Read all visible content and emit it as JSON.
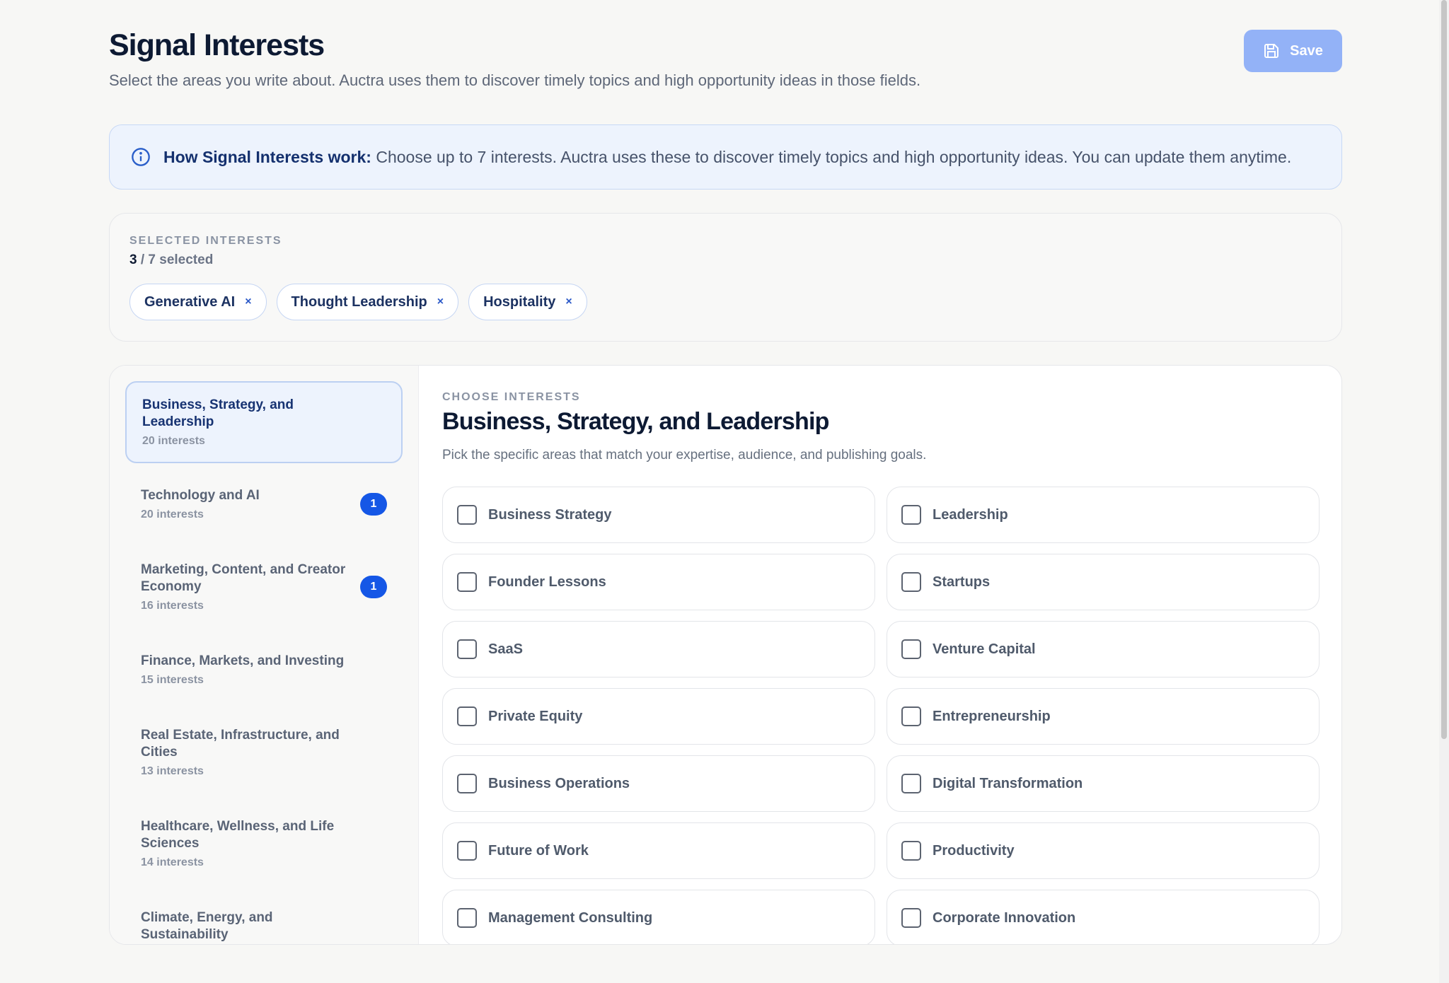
{
  "header": {
    "title": "Signal Interests",
    "subtitle": "Select the areas you write about. Auctra uses them to discover timely topics and high opportunity ideas in those fields.",
    "save_label": "Save"
  },
  "info_banner": {
    "bold": "How Signal Interests work:",
    "text": " Choose up to 7 interests. Auctra uses these to discover timely topics and high opportunity ideas. You can update them anytime."
  },
  "selected": {
    "label": "SELECTED INTERESTS",
    "count": "3",
    "count_suffix": " / 7 selected",
    "chips": [
      {
        "label": "Generative AI",
        "remove": "×"
      },
      {
        "label": "Thought Leadership",
        "remove": "×"
      },
      {
        "label": "Hospitality",
        "remove": "×"
      }
    ]
  },
  "sidebar": {
    "categories": [
      {
        "name": "Business, Strategy, and Leadership",
        "count": "20 interests",
        "badge": ""
      },
      {
        "name": "Technology and AI",
        "count": "20 interests",
        "badge": "1"
      },
      {
        "name": "Marketing, Content, and Creator Economy",
        "count": "16 interests",
        "badge": "1"
      },
      {
        "name": "Finance, Markets, and Investing",
        "count": "15 interests",
        "badge": ""
      },
      {
        "name": "Real Estate, Infrastructure, and Cities",
        "count": "13 interests",
        "badge": ""
      },
      {
        "name": "Healthcare, Wellness, and Life Sciences",
        "count": "14 interests",
        "badge": ""
      },
      {
        "name": "Climate, Energy, and Sustainability",
        "count": "",
        "badge": ""
      }
    ]
  },
  "content": {
    "label": "CHOOSE INTERESTS",
    "title": "Business, Strategy, and Leadership",
    "description": "Pick the specific areas that match your expertise, audience, and publishing goals.",
    "options": [
      "Business Strategy",
      "Leadership",
      "Founder Lessons",
      "Startups",
      "SaaS",
      "Venture Capital",
      "Private Equity",
      "Entrepreneurship",
      "Business Operations",
      "Digital Transformation",
      "Future of Work",
      "Productivity",
      "Management Consulting",
      "Corporate Innovation"
    ]
  },
  "colors": {
    "accent": "#1557e6",
    "save_button": "#93b2f7",
    "banner_bg": "#edf3fd"
  },
  "icons": {
    "save": "save-icon",
    "info": "info-icon"
  }
}
